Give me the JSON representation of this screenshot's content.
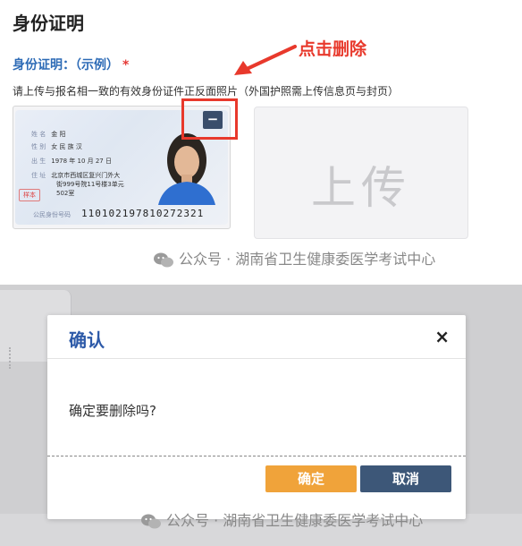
{
  "top": {
    "section_title": "身份证明",
    "field_label": "身份证明：（示例）",
    "required_mark": "*",
    "hint": "请上传与报名相一致的有效身份证件正反面照片（外国护照需上传信息页与封页）",
    "annotation": "点击删除",
    "delete_symbol": "−",
    "upload_label": "上传",
    "id_card": {
      "rows": [
        {
          "label": "姓 名",
          "value": "金 阳"
        },
        {
          "label": "性 别",
          "value": "女    民 族 汉"
        },
        {
          "label": "出 生",
          "value": "1978  年 10  月 27  日"
        },
        {
          "label": "住 址",
          "value": "北京市西城区复兴门外大"
        },
        {
          "label": "",
          "value": "街999号院11号楼3单元"
        },
        {
          "label": "",
          "value": "502室"
        }
      ],
      "stamp": "样本",
      "id_label": "公民身份号码",
      "id_number": "110102197810272321"
    }
  },
  "watermark": "公众号 · 湖南省卫生健康委医学考试中心",
  "dialog": {
    "title": "确认",
    "close": "×",
    "message": "确定要删除吗?",
    "ok": "确定",
    "cancel": "取消"
  },
  "colors": {
    "accent_red": "#e8392c",
    "title_blue": "#2d5aa8",
    "ok_orange": "#f0a33a",
    "cancel_navy": "#3d5778"
  }
}
